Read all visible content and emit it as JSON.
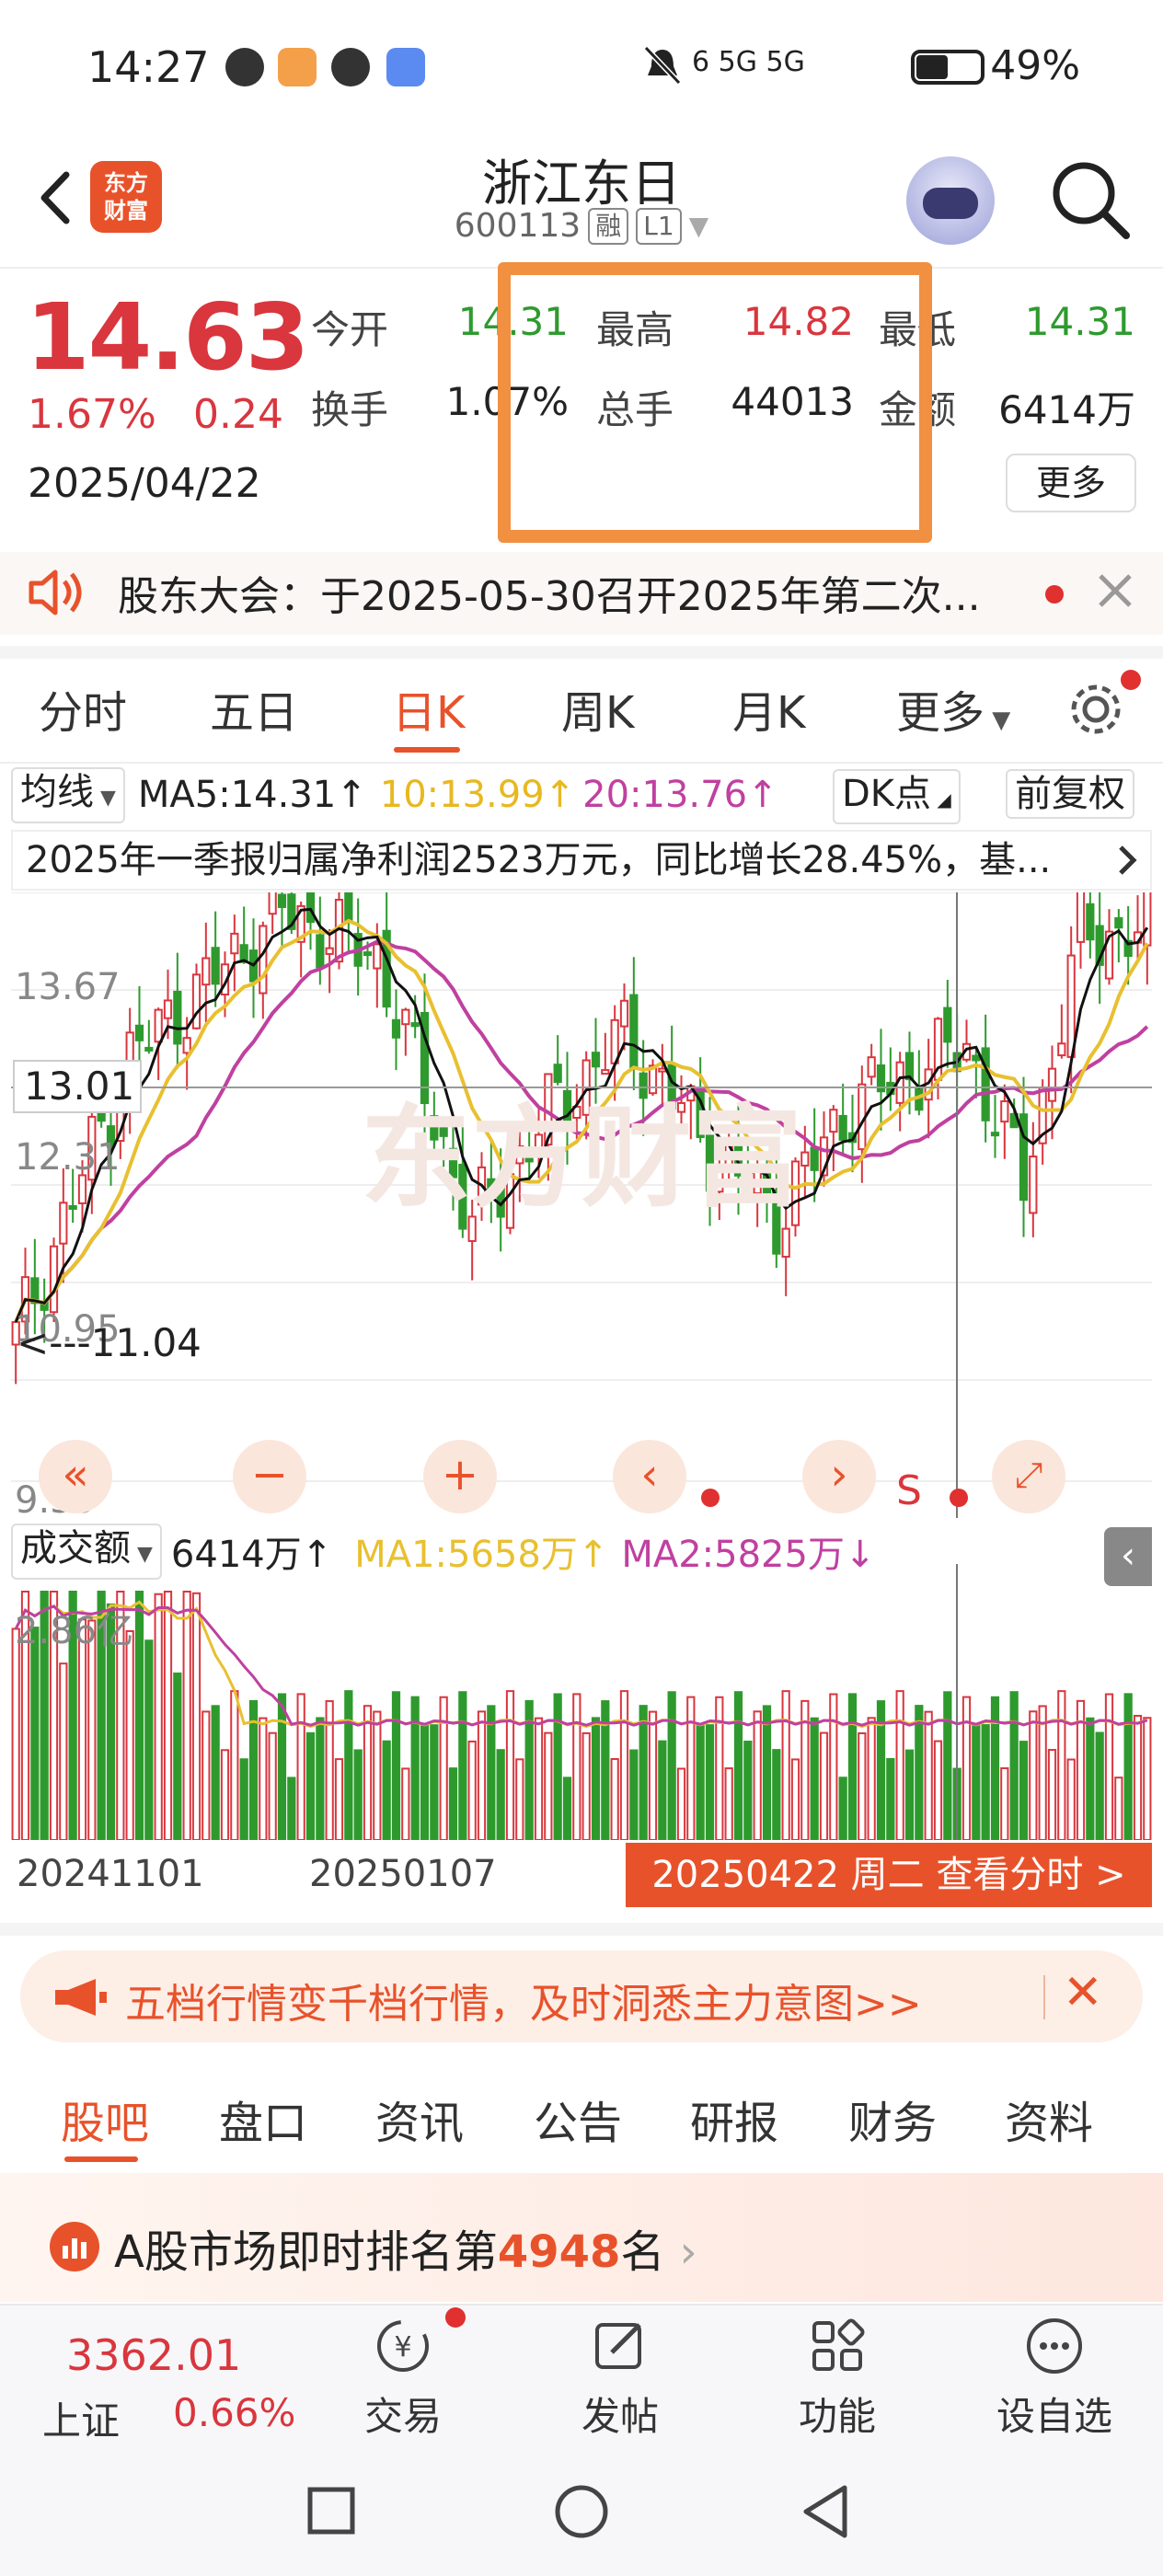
{
  "status_bar": {
    "time": "14:27",
    "network": "6 5G 5G",
    "battery": "49%"
  },
  "header": {
    "logo_text": "东方财富",
    "stock_name": "浙江东日",
    "stock_code": "600113",
    "tag_margin": "融",
    "tag_level": "L1"
  },
  "quote": {
    "price": "14.63",
    "change_pct": "1.67%",
    "change": "0.24",
    "date": "2025/04/22",
    "open_label": "今开",
    "open_value": "14.31",
    "high_label": "最高",
    "high_value": "14.82",
    "low_label": "最低",
    "low_value": "14.31",
    "turnover_label": "换手",
    "turnover_value": "1.07%",
    "volume_label": "总手",
    "volume_value": "44013",
    "amount_label": "金额",
    "amount_value": "6414万",
    "more_label": "更多"
  },
  "notice": {
    "text": "股东大会：于2025-05-30召开2025年第二次..."
  },
  "chart_tabs": {
    "items": [
      "分时",
      "五日",
      "日K",
      "周K",
      "月K",
      "更多"
    ],
    "active": "日K"
  },
  "ma_row": {
    "selector": "均线",
    "ma5": "MA5:14.31↑",
    "ma10": "10:13.99↑",
    "ma20": "20:13.76↑",
    "dk": "DK点",
    "adjust": "前复权"
  },
  "report": {
    "text": "2025年一季报归属净利润2523万元，同比增长28.45%，基..."
  },
  "chart_labels": {
    "y1": "13.67",
    "y2": "13.01",
    "y3": "12.31",
    "y4": "10.95",
    "y5": "9.59",
    "low_marker": "<---11.04",
    "s_marker": "S"
  },
  "volume_row": {
    "selector": "成交额",
    "value": "6414万↑",
    "ma1": "MA1:5658万↑",
    "ma2": "MA2:5825万↓",
    "ymax": "2.86亿"
  },
  "date_axis": {
    "start": "20241101",
    "mid": "20250107",
    "view_button": "20250422 周二 查看分时 >"
  },
  "promo": {
    "text": "五档行情变千档行情，及时洞悉主力意图>>"
  },
  "bottom_tabs": {
    "items": [
      "股吧",
      "盘口",
      "资讯",
      "公告",
      "研报",
      "财务",
      "资料"
    ],
    "active": "股吧"
  },
  "rank": {
    "prefix": "A股市场即时排名第",
    "number": "4948",
    "suffix": "名"
  },
  "bottom_nav": {
    "index_value": "3362.01",
    "index_name": "上证",
    "index_pct": "0.66%",
    "trade": "交易",
    "post": "发帖",
    "functions": "功能",
    "watch": "设自选"
  },
  "colors": {
    "up": "#d9363e",
    "down": "#2e9a2e",
    "accent": "#e8522b",
    "ma5": "#111111",
    "ma10": "#e8c030",
    "ma20": "#c040a0"
  }
}
